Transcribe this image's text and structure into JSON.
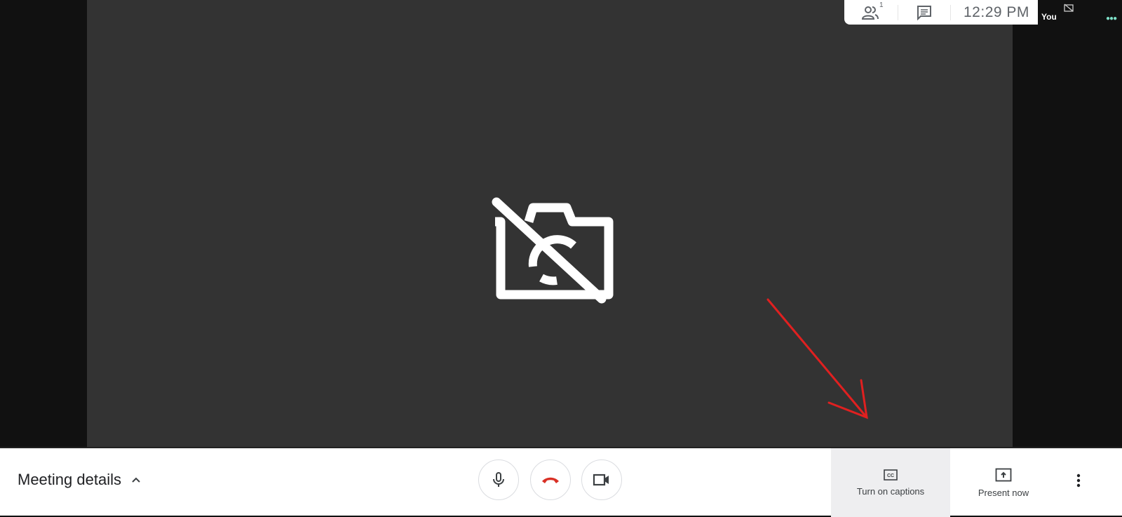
{
  "topbar": {
    "participants_count": "1",
    "time": "12:29  PM"
  },
  "self_tile": {
    "label": "You"
  },
  "bottombar": {
    "meeting_details": "Meeting details",
    "captions_label": "Turn on captions",
    "present_label": "Present now"
  },
  "colors": {
    "hangup": "#d93025",
    "annotation_arrow": "#e02020",
    "stage": "#333333"
  }
}
